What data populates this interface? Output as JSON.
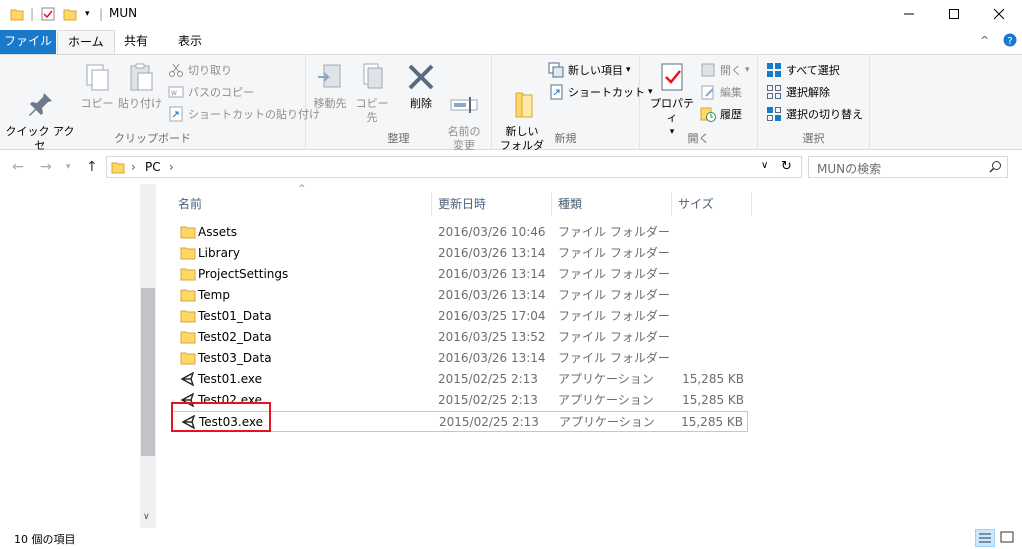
{
  "window": {
    "title": "MUN",
    "minimize_icon": "minimize-icon",
    "maximize_icon": "maximize-icon",
    "close_icon": "close-icon"
  },
  "ribbon_tabs": [
    {
      "label": "ファイル"
    },
    {
      "label": "ホーム"
    },
    {
      "label": "共有"
    },
    {
      "label": "表示"
    }
  ],
  "ribbon": {
    "clipboard": {
      "pin_label": "クイック アクセ\nスにピン留め",
      "copy_label": "コピー",
      "paste_label": "貼り付け",
      "cut_label": "切り取り",
      "copy_path_label": "パスのコピー",
      "paste_shortcut_label": "ショートカットの貼り付け",
      "group_label": "クリップボード"
    },
    "organize": {
      "move_label": "移動先",
      "copyto_label": "コピー先",
      "delete_label": "削除",
      "rename_label": "名前の\n変更",
      "group_label": "整理"
    },
    "new": {
      "new_folder_label": "新しい\nフォルダー",
      "new_item_label": "新しい項目",
      "shortcut_label": "ショートカット",
      "group_label": "新規"
    },
    "open": {
      "properties_label": "プロパティ",
      "open_label": "開く",
      "edit_label": "編集",
      "history_label": "履歴",
      "group_label": "開く"
    },
    "select": {
      "select_all_label": "すべて選択",
      "select_none_label": "選択解除",
      "invert_label": "選択の切り替え",
      "group_label": "選択"
    }
  },
  "address": {
    "crumb": "PC",
    "search_placeholder": "MUNの検索"
  },
  "columns": {
    "name": "名前",
    "date": "更新日時",
    "type": "種類",
    "size": "サイズ"
  },
  "files": [
    {
      "name": "Assets",
      "date": "2016/03/26 10:46",
      "type": "ファイル フォルダー",
      "size": "",
      "icon": "folder-icon"
    },
    {
      "name": "Library",
      "date": "2016/03/26 13:14",
      "type": "ファイル フォルダー",
      "size": "",
      "icon": "folder-icon"
    },
    {
      "name": "ProjectSettings",
      "date": "2016/03/26 13:14",
      "type": "ファイル フォルダー",
      "size": "",
      "icon": "folder-icon"
    },
    {
      "name": "Temp",
      "date": "2016/03/26 13:14",
      "type": "ファイル フォルダー",
      "size": "",
      "icon": "folder-icon"
    },
    {
      "name": "Test01_Data",
      "date": "2016/03/25 17:04",
      "type": "ファイル フォルダー",
      "size": "",
      "icon": "folder-icon"
    },
    {
      "name": "Test02_Data",
      "date": "2016/03/25 13:52",
      "type": "ファイル フォルダー",
      "size": "",
      "icon": "folder-icon"
    },
    {
      "name": "Test03_Data",
      "date": "2016/03/26 13:14",
      "type": "ファイル フォルダー",
      "size": "",
      "icon": "folder-icon"
    },
    {
      "name": "Test01.exe",
      "date": "2015/02/25 2:13",
      "type": "アプリケーション",
      "size": "15,285 KB",
      "icon": "unity-icon"
    },
    {
      "name": "Test02.exe",
      "date": "2015/02/25 2:13",
      "type": "アプリケーション",
      "size": "15,285 KB",
      "icon": "unity-icon"
    },
    {
      "name": "Test03.exe",
      "date": "2015/02/25 2:13",
      "type": "アプリケーション",
      "size": "15,285 KB",
      "icon": "unity-icon"
    }
  ],
  "status": {
    "item_count": "10 個の項目"
  },
  "colors": {
    "accent": "#1979ca",
    "folder": "#ffd764",
    "highlight_box": "#e81123",
    "selection_border": "#99d1ff"
  }
}
